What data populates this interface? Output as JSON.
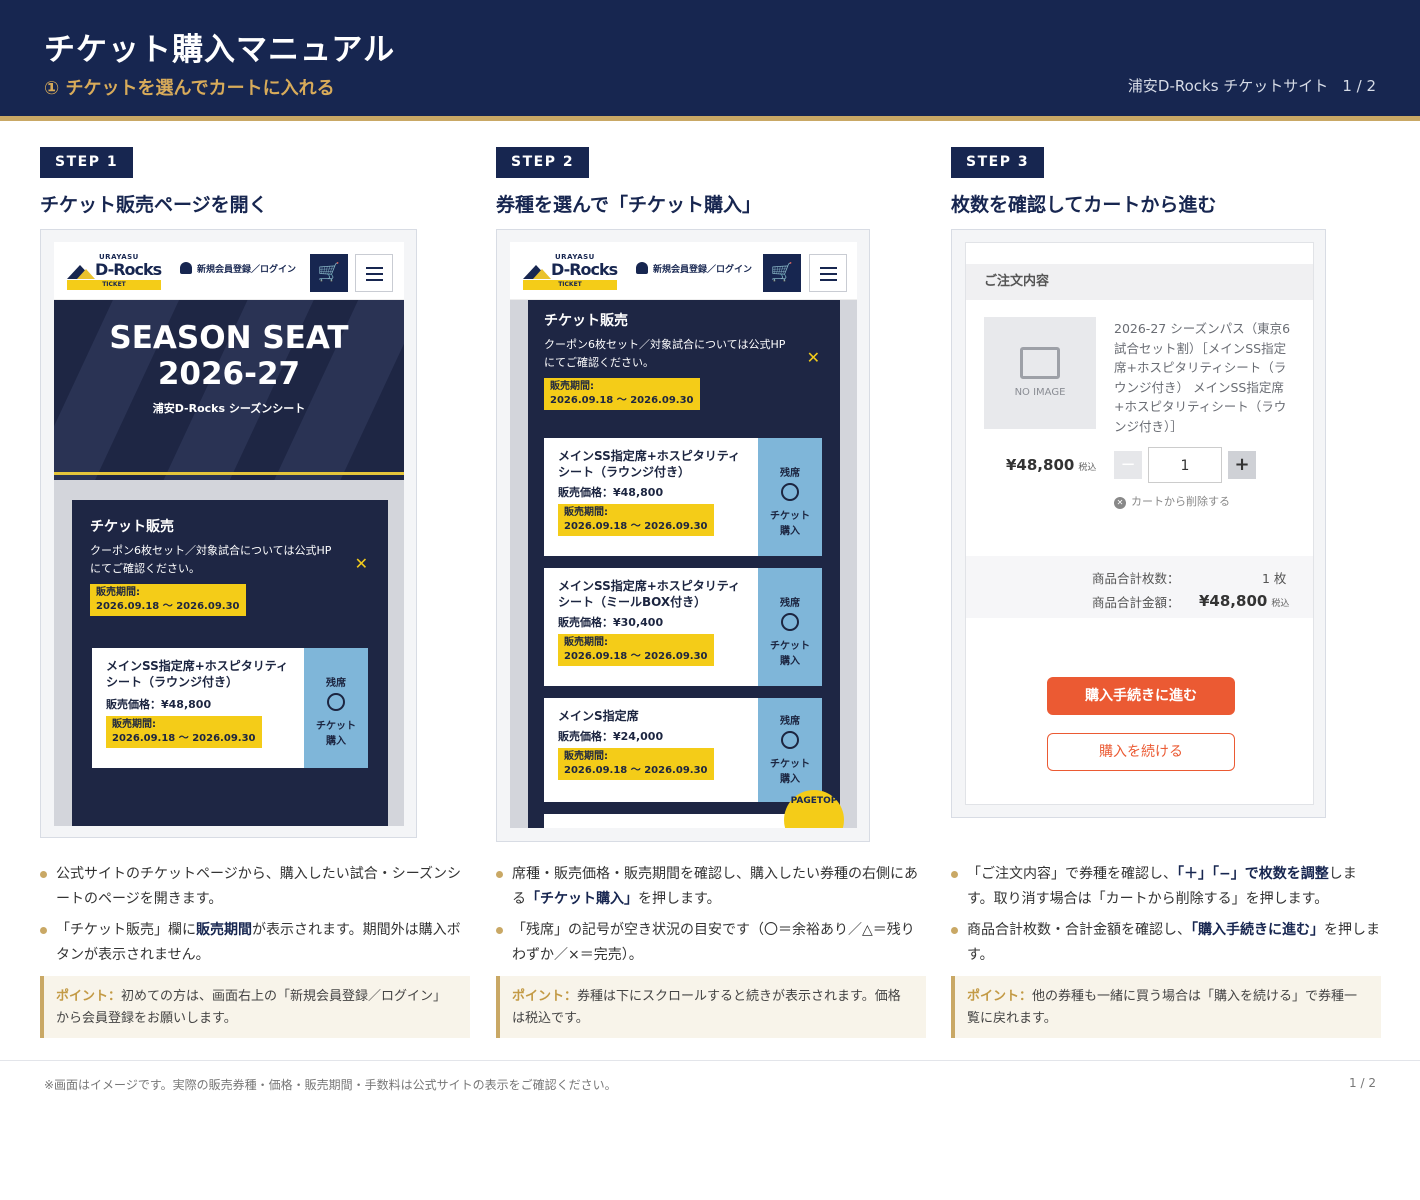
{
  "header": {
    "title": "チケット購入マニュアル",
    "subtitle": "① チケットを選んでカートに入れる",
    "site": "浦安D-Rocks チケットサイト",
    "page": "1 / 2"
  },
  "site_header": {
    "logo_top": "URAYASU",
    "logo_main": "D-Rocks",
    "logo_tag": "TICKET",
    "login": "新規会員登録／ログイン",
    "cart_icon": "cart-icon",
    "menu_icon": "hamburger-icon"
  },
  "steps": [
    {
      "badge": "STEP 1",
      "title": "チケット販売ページを開く",
      "hero": {
        "line1": "SEASON SEAT",
        "line2": "2026-27",
        "caption": "浦安D-Rocks シーズンシート"
      },
      "sales": {
        "title": "チケット販売",
        "note": "クーポン6枚セット／対象試合については公式HPにてご確認ください。",
        "close": "✕",
        "period": "販売期間:\n2026.09.18 ～ 2026.09.30"
      },
      "ticket": {
        "name": "メインSS指定席+ホスピタリティシート（ラウンジ付き）",
        "price": "販売価格：¥48,800",
        "period": "販売期間:\n2026.09.18 ～ 2026.09.30",
        "zan": "残席",
        "buy": "チケット\n購入"
      },
      "bullets": [
        {
          "text": "公式サイトのチケットページから、購入したい試合・シーズンシートのページを開きます。"
        },
        {
          "before": "「チケット販売」欄に",
          "bold": "販売期間",
          "after": "が表示されます。期間外は購入ボタンが表示されません。"
        }
      ],
      "point_label": "ポイント：",
      "point_text": "初めての方は、画面右上の「新規会員登録／ログイン」から会員登録をお願いします。"
    },
    {
      "badge": "STEP 2",
      "title": "券種を選んで「チケット購入」",
      "sales": {
        "title": "チケット販売",
        "note": "クーポン6枚セット／対象試合については公式HPにてご確認ください。",
        "close": "✕",
        "period": "販売期間:\n2026.09.18 ～ 2026.09.30"
      },
      "tickets": [
        {
          "name": "メインSS指定席+ホスピタリティシート（ラウンジ付き）",
          "price": "販売価格：¥48,800",
          "period": "販売期間:\n2026.09.18 ～ 2026.09.30",
          "zan": "残席",
          "buy": "チケット\n購入"
        },
        {
          "name": "メインSS指定席+ホスピタリティシート（ミールBOX付き）",
          "price": "販売価格：¥30,400",
          "period": "販売期間:\n2026.09.18 ～ 2026.09.30",
          "zan": "残席",
          "buy": "チケット\n購入"
        },
        {
          "name": "メインS指定席",
          "price": "販売価格：¥24,000",
          "period": "販売期間:\n2026.09.18 ～ 2026.09.30",
          "zan": "残席",
          "buy": "チケット\n購入"
        }
      ],
      "pagetop": "PAGETOP",
      "bullets": [
        {
          "before": "席種・販売価格・販売期間を確認し、購入したい券種の右側にある",
          "bold": "「チケット購入」",
          "after": "を押します。"
        },
        {
          "text": "「残席」の記号が空き状況の目安です（〇＝余裕あり／△＝残りわずか／×＝完売）。"
        }
      ],
      "point_label": "ポイント：",
      "point_text": "券種は下にスクロールすると続きが表示されます。価格は税込です。"
    },
    {
      "badge": "STEP 3",
      "title": "枚数を確認してカートから進む",
      "cart": {
        "order_head": "ご注文内容",
        "no_image": "NO IMAGE",
        "product": "2026-27 シーズンパス（東京6試合セット割）［メインSS指定席+ホスピタリティシート（ラウンジ付き） メインSS指定席+ホスピタリティシート（ラウンジ付き）］",
        "price": "¥48,800",
        "tax": "税込",
        "minus": "−",
        "qty": "1",
        "plus": "+",
        "remove": "カートから削除する",
        "count_label": "商品合計枚数：",
        "count_value": "1 枚",
        "total_label": "商品合計金額：",
        "total_value": "¥48,800",
        "total_tax": "税込",
        "proceed": "購入手続きに進む",
        "continue": "購入を続ける"
      },
      "bullets": [
        {
          "before": "「ご注文内容」で券種を確認し、",
          "bold": "「＋」「−」で枚数を調整",
          "after": "します。取り消す場合は「カートから削除する」を押します。"
        },
        {
          "before": "商品合計枚数・合計金額を確認し、",
          "bold": "「購入手続きに進む」",
          "after": "を押します。"
        }
      ],
      "point_label": "ポイント：",
      "point_text": "他の券種も一緒に買う場合は「購入を続ける」で券種一覧に戻れます。"
    }
  ],
  "footer": {
    "note": "※画面はイメージです。実際の販売券種・価格・販売期間・手数料は公式サイトの表示をご確認ください。",
    "page": "1 / 2"
  },
  "colors": {
    "navy": "#172650",
    "gold": "#c9a865",
    "yellow": "#f4cc18",
    "orange": "#eb5a33",
    "lightblue": "#7fb6d9"
  }
}
